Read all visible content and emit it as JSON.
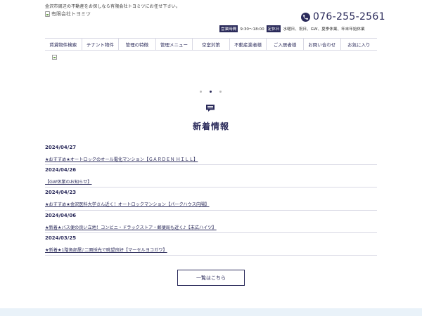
{
  "header": {
    "tagline": "金沢市周辺の不動産をお探しなら有限会社トヨミツにお任せ下さい。",
    "logo_alt": "有限会社トヨミツ",
    "phone": "076-255-2561",
    "business_hours_label": "営業時間",
    "business_hours": "9:30～18:00",
    "holiday_label": "定休日",
    "holidays": "水曜日、祝日、GW、夏季休業、年末年始休業"
  },
  "nav": {
    "items": [
      "賃貸物件検索",
      "テナント物件",
      "管理の特徴",
      "管理メニュー",
      "空室対策",
      "不動産業者様",
      "ご入居者様",
      "お問い合わせ",
      "お気に入り"
    ]
  },
  "carousel": {
    "slide_count": 3,
    "active_index": 1
  },
  "news": {
    "title": "新着情報",
    "items": [
      {
        "date": "2024/04/27",
        "title": "★おすすめ★オートロックのオール電化マンション【ＧＡＲＤＥＮ ＨＩＬＬ】"
      },
      {
        "date": "2024/04/26",
        "title": "【GW休業のお知らせ】"
      },
      {
        "date": "2024/04/23",
        "title": "★おすすめ★金沢医科大学さん近く！オートロックマンション【パークハウス向陽】"
      },
      {
        "date": "2024/04/06",
        "title": "★新着★バス便の良い立地！コンビニ・ドラックストア・郵便局も近く♪【末広ハイツ】"
      },
      {
        "date": "2024/03/25",
        "title": "★新着★1階角部屋♪二面採光で眺望良好【マーセルヨコガワ】"
      }
    ],
    "more_label": "一覧はこちら"
  },
  "colors": {
    "navy": "#2a2a5a",
    "divider": "#d8d8e4",
    "footer_band": "#e9f2f9"
  }
}
